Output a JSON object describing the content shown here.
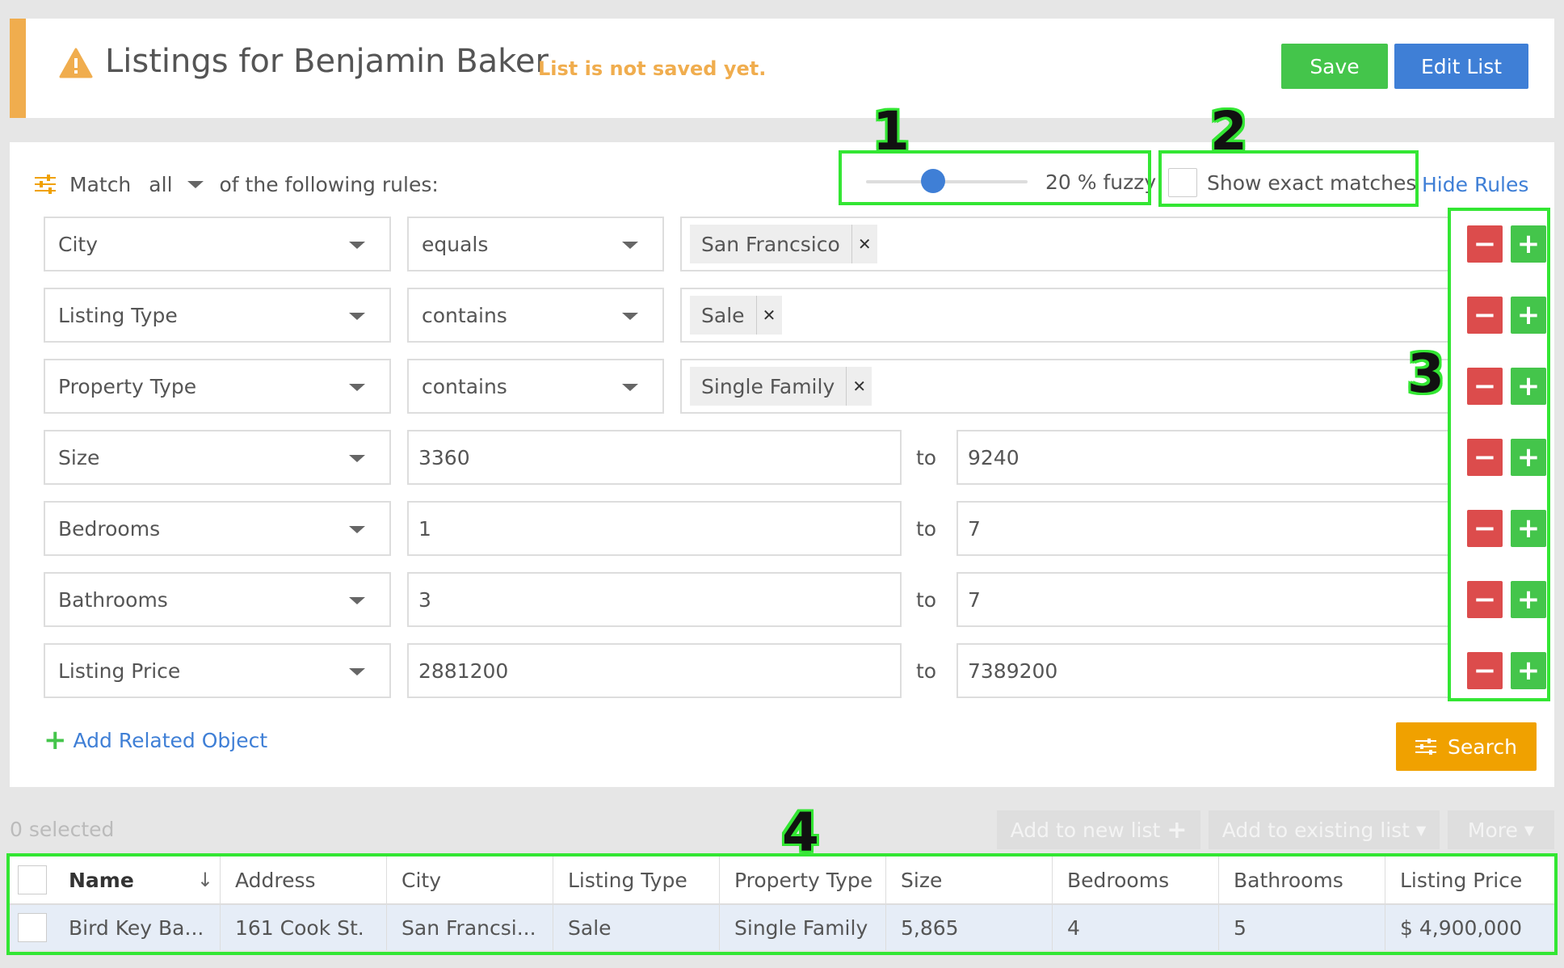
{
  "header": {
    "title": "Listings for Benjamin Baker",
    "status": "List is not saved yet.",
    "save_label": "Save",
    "edit_label": "Edit List"
  },
  "rules": {
    "match_label": "Match",
    "match_mode": "all",
    "match_tail": "of the following rules:",
    "fuzzy_percent": 20,
    "fuzzy_label": "20 % fuzzy",
    "exact_label": "Show exact matches",
    "exact_checked": false,
    "hide_rules_label": "Hide Rules",
    "items": [
      {
        "field": "City",
        "operator": "equals",
        "tags": [
          "San Francsico"
        ]
      },
      {
        "field": "Listing Type",
        "operator": "contains",
        "tags": [
          "Sale"
        ]
      },
      {
        "field": "Property Type",
        "operator": "contains",
        "tags": [
          "Single Family"
        ]
      },
      {
        "field": "Size",
        "from": "3360",
        "to_label": "to",
        "to": "9240"
      },
      {
        "field": "Bedrooms",
        "from": "1",
        "to_label": "to",
        "to": "7"
      },
      {
        "field": "Bathrooms",
        "from": "3",
        "to_label": "to",
        "to": "7"
      },
      {
        "field": "Listing Price",
        "from": "2881200",
        "to_label": "to",
        "to": "7389200"
      }
    ],
    "add_related_label": "Add Related Object",
    "search_label": "Search"
  },
  "callouts": [
    "1",
    "2",
    "3",
    "4"
  ],
  "results": {
    "selected_text": "0 selected",
    "add_new_label": "Add to new list",
    "add_existing_label": "Add to existing list",
    "more_label": "More",
    "columns": [
      "Name",
      "Address",
      "City",
      "Listing Type",
      "Property Type",
      "Size",
      "Bedrooms",
      "Bathrooms",
      "Listing Price"
    ],
    "sort_icon": "arrow-down-icon",
    "rows": [
      [
        "Bird Key Ba...",
        "161 Cook St.",
        "San Francsi...",
        "Sale",
        "Single Family",
        "5,865",
        "4",
        "5",
        "$ 4,900,000"
      ]
    ]
  },
  "colors": {
    "accent_orange": "#f0ad4e",
    "save_green": "#44c54b",
    "edit_blue": "#3f7fd6",
    "minus_red": "#dc4c4c",
    "search_orange": "#f0a100",
    "highlight_green": "#33e633"
  }
}
